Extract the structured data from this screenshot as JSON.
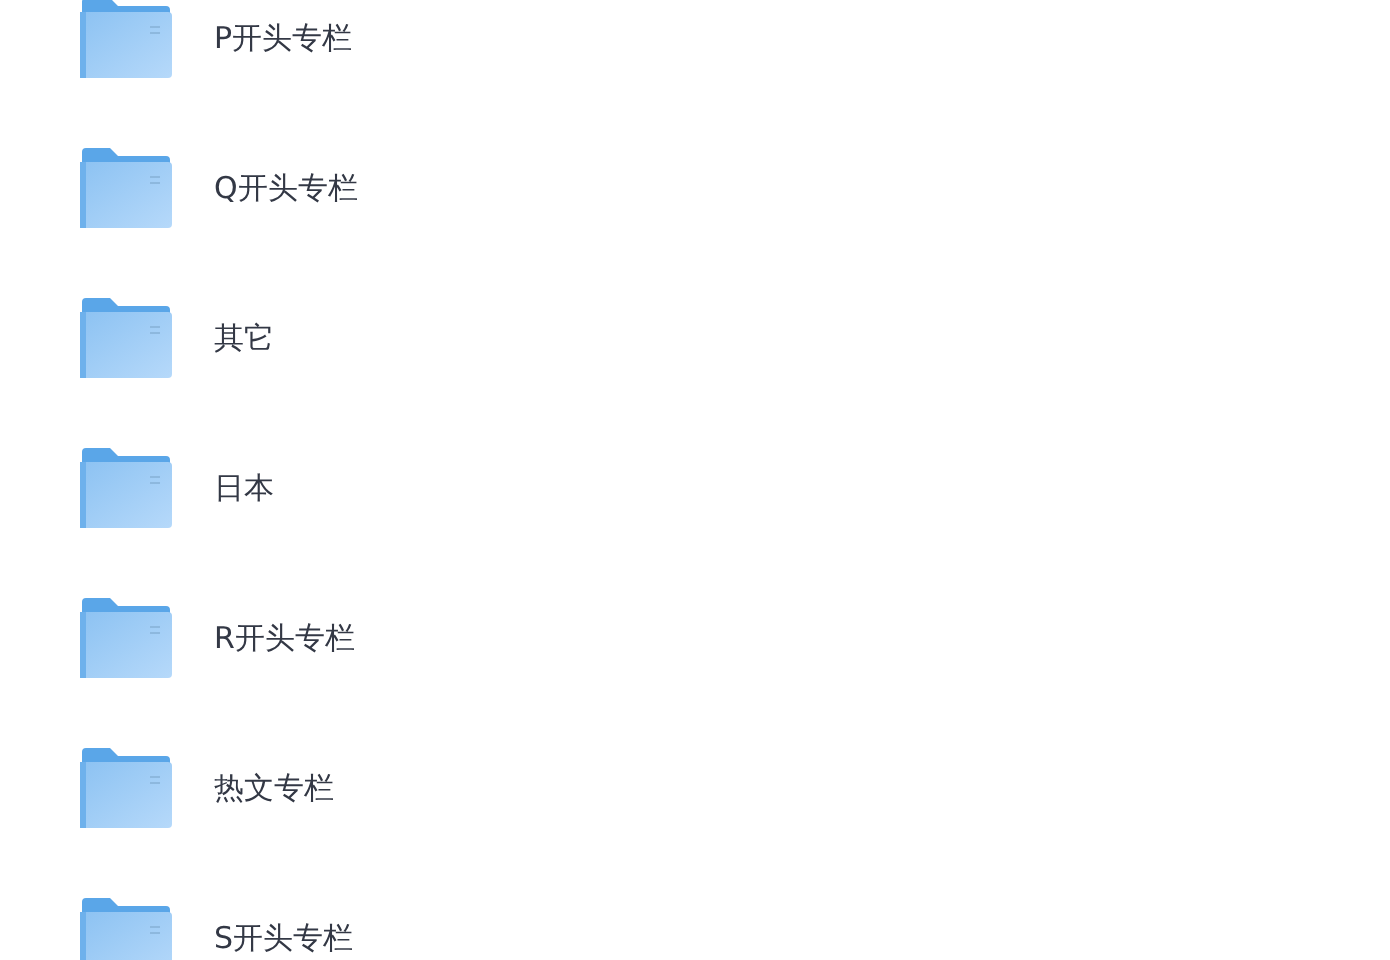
{
  "folders": [
    {
      "name": "P开头专栏"
    },
    {
      "name": "Q开头专栏"
    },
    {
      "name": "其它"
    },
    {
      "name": "日本"
    },
    {
      "name": "R开头专栏"
    },
    {
      "name": "热文专栏"
    },
    {
      "name": "S开头专栏"
    }
  ]
}
